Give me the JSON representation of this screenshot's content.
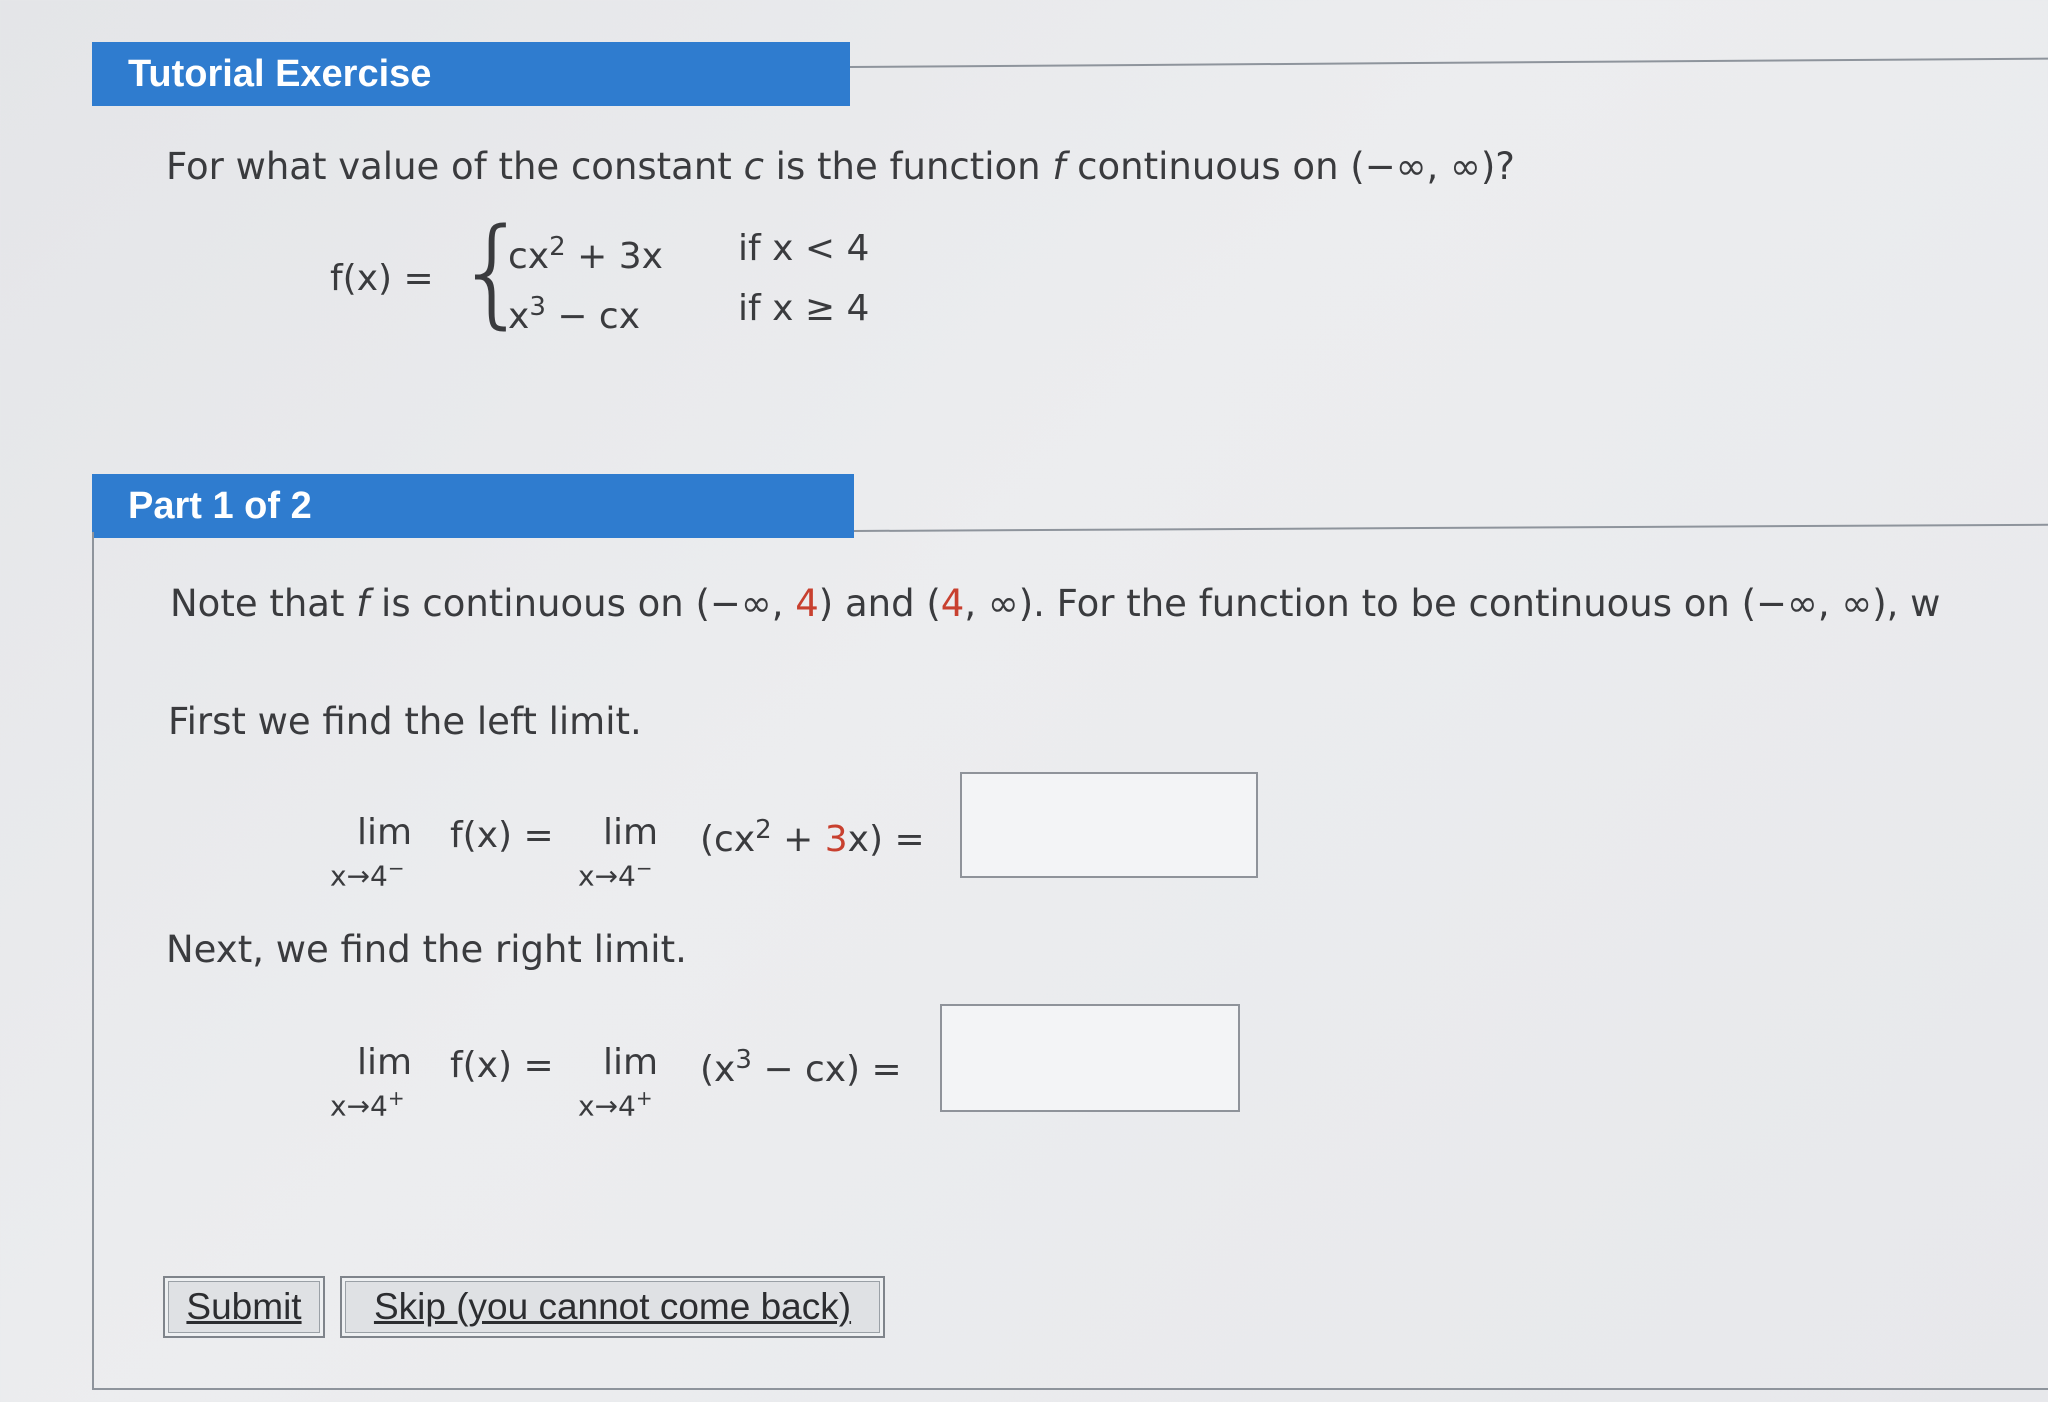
{
  "exercise": {
    "header": "Tutorial Exercise",
    "question": {
      "pre": "For what value of the constant ",
      "var_c": "c",
      "mid": " is the function ",
      "var_f": "f",
      "post": " continuous on (−∞, ∞)?"
    },
    "function": {
      "lhs": "f(x) =",
      "case1": {
        "expr_base": "cx",
        "expr_exp": "2",
        "expr_rest": " + 3x",
        "condition": "if x < 4"
      },
      "case2": {
        "expr_base": "x",
        "expr_exp": "3",
        "expr_rest": " − cx",
        "condition": "if x ≥ 4"
      }
    }
  },
  "part": {
    "header": "Part 1 of 2",
    "note": {
      "pre": "Note that ",
      "var_f": "f",
      "mid": " is continuous on (−∞, ",
      "n1": "4",
      "mid2": ") and (",
      "n2": "4",
      "post": ", ∞). For the function to be continuous on (−∞, ∞), w"
    },
    "left_intro": "First we find the left limit.",
    "left_limit": {
      "lim": "lim",
      "sub": "x→4",
      "sub_sign": "−",
      "fx": "f(x) =",
      "paren_open": "(cx",
      "exp": "2",
      "mid": " + ",
      "num": "3",
      "tail": "x) =",
      "answer": ""
    },
    "right_intro": "Next, we find the right limit.",
    "right_limit": {
      "lim": "lim",
      "sub": "x→4",
      "sub_sign": "+",
      "fx": "f(x) =",
      "paren_open": "(x",
      "exp": "3",
      "tail": " − cx) =",
      "answer": ""
    }
  },
  "buttons": {
    "submit": "Submit",
    "skip": "Skip (you cannot come back)"
  }
}
